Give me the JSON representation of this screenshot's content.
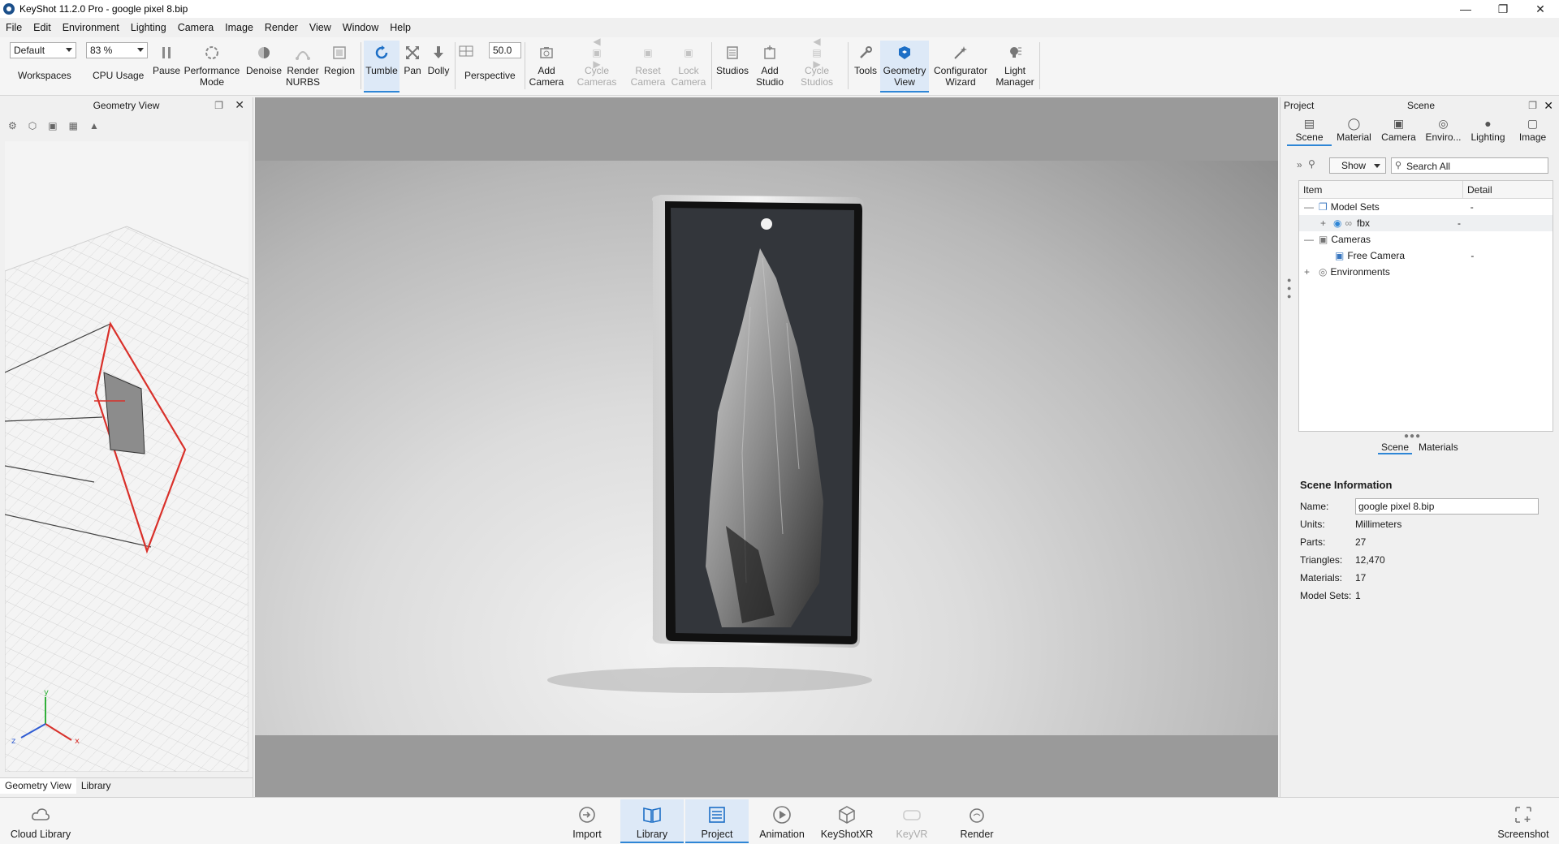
{
  "window": {
    "title": "KeyShot 11.2.0 Pro  - google pixel 8.bip"
  },
  "menu": [
    "File",
    "Edit",
    "Environment",
    "Lighting",
    "Camera",
    "Image",
    "Render",
    "View",
    "Window",
    "Help"
  ],
  "ribbon": {
    "workspace_value": "Default",
    "workspaces_label": "Workspaces",
    "cpu_value": "83 %",
    "cpu_label": "CPU Usage",
    "pause": "Pause",
    "performance_mode": "Performance Mode",
    "denoise": "Denoise",
    "render_nurbs": "Render NURBS",
    "region": "Region",
    "tumble": "Tumble",
    "pan": "Pan",
    "dolly": "Dolly",
    "fov_value": "50.0",
    "perspective": "Perspective",
    "add_camera": "Add Camera",
    "cycle_cameras": "Cycle Cameras",
    "reset_camera": "Reset Camera",
    "lock_camera": "Lock Camera",
    "studios": "Studios",
    "add_studio": "Add Studio",
    "cycle_studios": "Cycle Studios",
    "tools": "Tools",
    "geometry_view": "Geometry View",
    "configurator_wizard": "Configurator Wizard",
    "light_manager": "Light Manager"
  },
  "left_panel": {
    "title": "Geometry View",
    "tabs": [
      "Geometry View",
      "Library"
    ],
    "axes": {
      "x": "x",
      "y": "y",
      "z": "z"
    }
  },
  "right_panel": {
    "left_title": "Project",
    "title": "Scene",
    "tabs": [
      "Scene",
      "Material",
      "Camera",
      "Enviro...",
      "Lighting",
      "Image"
    ],
    "show_label": "Show",
    "search_placeholder": "Search All",
    "tree_headers": {
      "item": "Item",
      "detail": "Detail"
    },
    "tree": [
      {
        "label": "Model Sets",
        "detail": "-"
      },
      {
        "label": "fbx",
        "detail": "-"
      },
      {
        "label": "Cameras",
        "detail": ""
      },
      {
        "label": "Free Camera",
        "detail": "-"
      },
      {
        "label": "Environments",
        "detail": ""
      }
    ],
    "sub_tabs": [
      "Scene",
      "Materials"
    ],
    "info": {
      "title": "Scene Information",
      "name_label": "Name:",
      "name_value": "google pixel 8.bip",
      "units_label": "Units:",
      "units_value": "Millimeters",
      "parts_label": "Parts:",
      "parts_value": "27",
      "triangles_label": "Triangles:",
      "triangles_value": "12,470",
      "materials_label": "Materials:",
      "materials_value": "17",
      "model_sets_label": "Model Sets:",
      "model_sets_value": "1"
    }
  },
  "bottom_bar": {
    "cloud_library": "Cloud Library",
    "import": "Import",
    "library": "Library",
    "project": "Project",
    "animation": "Animation",
    "keyshotxr": "KeyShotXR",
    "keyvr": "KeyVR",
    "render": "Render",
    "screenshot": "Screenshot"
  }
}
